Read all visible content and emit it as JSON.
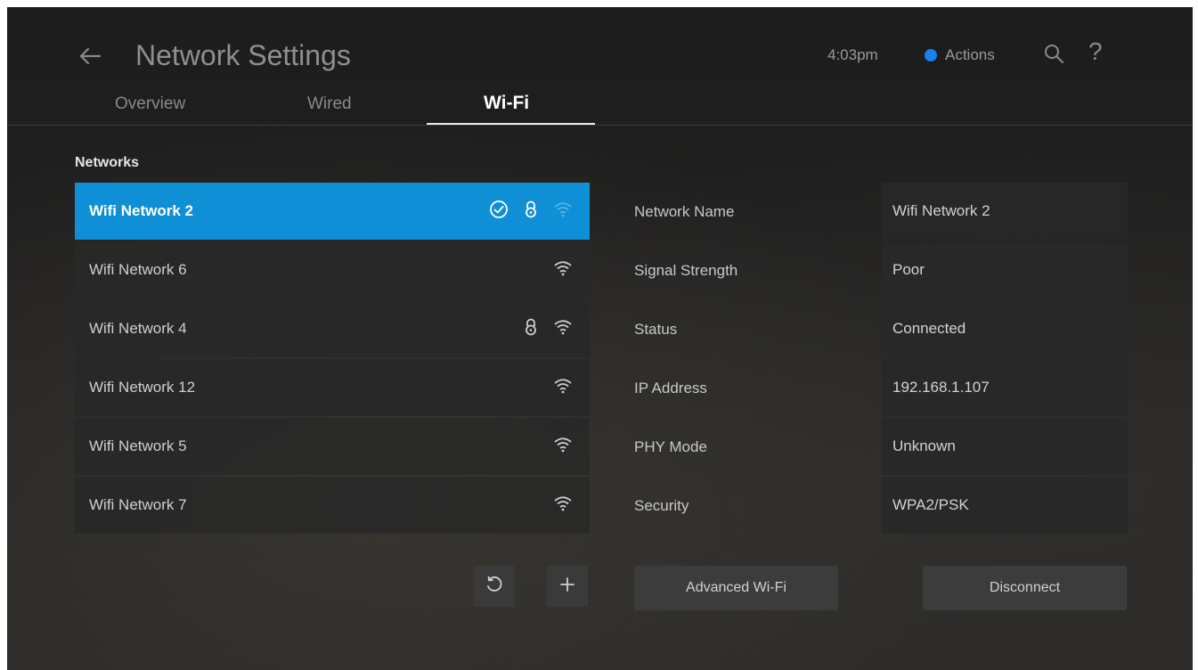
{
  "header": {
    "title": "Network Settings",
    "time": "4:03pm",
    "actions_label": "Actions",
    "help_symbol": "?",
    "accent_color": "#1a7ff0"
  },
  "tabs": [
    {
      "label": "Overview",
      "selected": false
    },
    {
      "label": "Wired",
      "selected": false
    },
    {
      "label": "Wi-Fi",
      "selected": true
    }
  ],
  "networks": {
    "section_label": "Networks",
    "items": [
      {
        "name": "Wifi Network 2",
        "selected": true,
        "connected": true,
        "secured": true,
        "icons": [
          "check-circle-icon",
          "lock-icon",
          "wifi-icon"
        ]
      },
      {
        "name": "Wifi Network 6",
        "selected": false,
        "icons": [
          "wifi-icon"
        ]
      },
      {
        "name": "Wifi Network 4",
        "selected": false,
        "secured": true,
        "icons": [
          "lock-icon",
          "wifi-icon"
        ]
      },
      {
        "name": "Wifi Network 12",
        "selected": false,
        "icons": [
          "wifi-icon"
        ]
      },
      {
        "name": "Wifi Network 5",
        "selected": false,
        "icons": [
          "wifi-icon"
        ]
      },
      {
        "name": "Wifi Network 7",
        "selected": false,
        "icons": [
          "wifi-icon"
        ]
      }
    ],
    "selected_color": "#0f8fd6"
  },
  "details": [
    {
      "label": "Network Name",
      "value": "Wifi Network 2"
    },
    {
      "label": "Signal Strength",
      "value": "Poor"
    },
    {
      "label": "Status",
      "value": "Connected"
    },
    {
      "label": "IP Address",
      "value": "192.168.1.107"
    },
    {
      "label": "PHY Mode",
      "value": "Unknown"
    },
    {
      "label": "Security",
      "value": "WPA2/PSK"
    }
  ],
  "buttons": {
    "refresh_icon": "refresh-icon",
    "add_icon": "plus-icon",
    "advanced_label": "Advanced Wi-Fi",
    "disconnect_label": "Disconnect"
  }
}
